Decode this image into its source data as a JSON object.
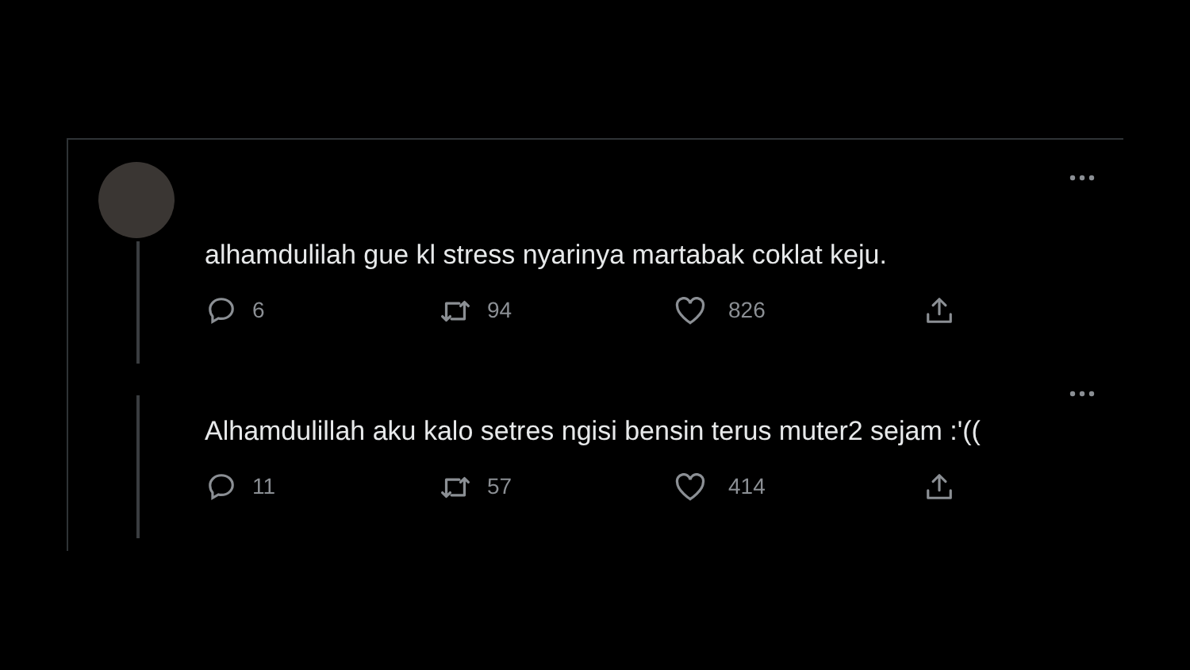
{
  "tweets": [
    {
      "text": "alhamdulilah gue kl stress nyarinya martabak coklat keju.",
      "has_avatar": true,
      "replies": "6",
      "retweets": "94",
      "likes": "826"
    },
    {
      "text": "Alhamdulillah aku kalo setres ngisi bensin terus muter2 sejam :'((",
      "has_avatar": false,
      "replies": "11",
      "retweets": "57",
      "likes": "414"
    }
  ]
}
